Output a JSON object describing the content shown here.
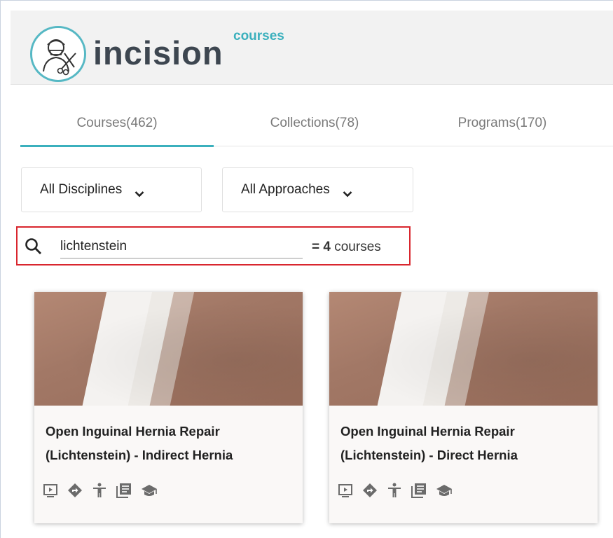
{
  "brand": {
    "name": "incision",
    "sub": "courses"
  },
  "tabs": [
    {
      "label": "Courses(462)",
      "active": true
    },
    {
      "label": "Collections(78)",
      "active": false
    },
    {
      "label": "Programs(170)",
      "active": false
    }
  ],
  "filters": {
    "discipline": "All Disciplines",
    "approach": "All Approaches"
  },
  "search": {
    "value": "lichtenstein",
    "result_prefix": "= ",
    "result_count": "4",
    "result_suffix": " courses"
  },
  "cards": [
    {
      "title": "Open Inguinal Hernia Repair (Lichtenstein) - Indirect Hernia",
      "icons": [
        "video-icon",
        "directions-icon",
        "accessibility-icon",
        "book-icon",
        "graduation-cap-icon"
      ]
    },
    {
      "title": "Open Inguinal Hernia Repair (Lichtenstein) - Direct Hernia",
      "icons": [
        "video-icon",
        "directions-icon",
        "accessibility-icon",
        "book-icon",
        "graduation-cap-icon"
      ]
    }
  ],
  "colors": {
    "accent": "#3bb0bd",
    "search_highlight": "#d9262e",
    "text_dark": "#222222",
    "tab_text": "#7a7a7a",
    "icon_gray": "#6b6b6b"
  }
}
